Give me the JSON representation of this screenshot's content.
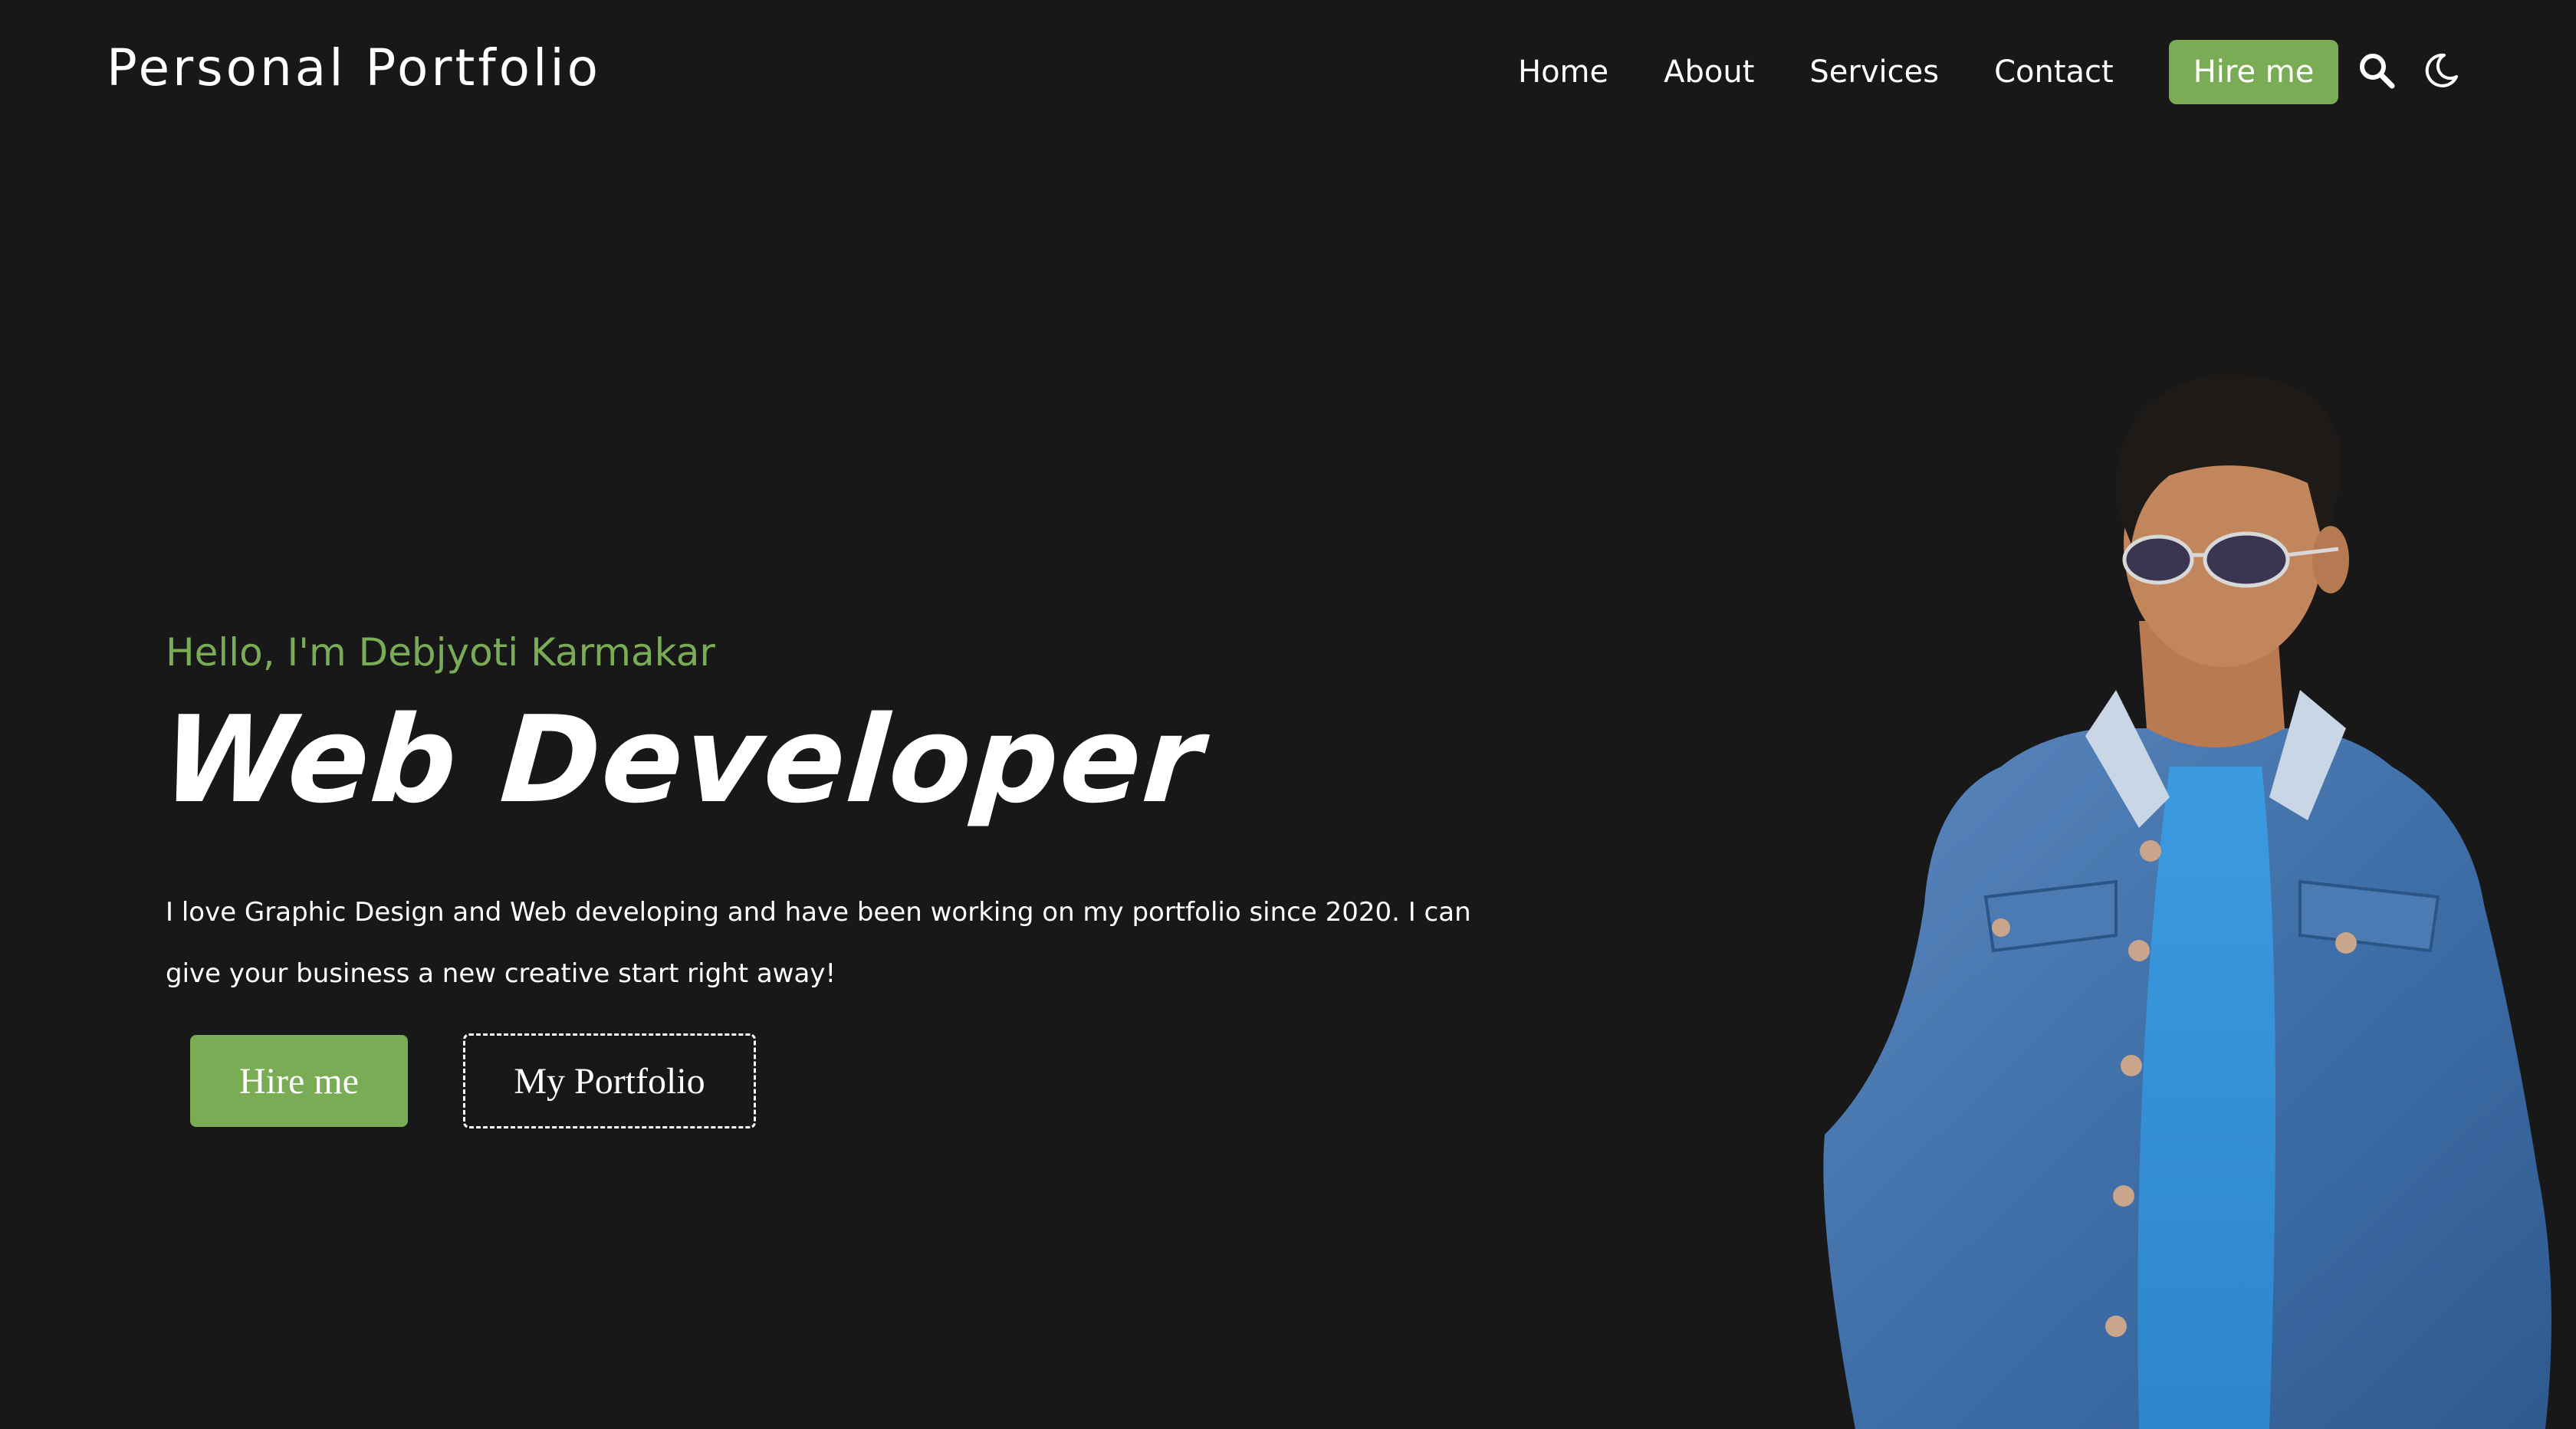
{
  "header": {
    "logo": "Personal Portfolio",
    "nav": {
      "home": "Home",
      "about": "About",
      "services": "Services",
      "contact": "Contact",
      "hire": "Hire me"
    },
    "icons": [
      "search-icon",
      "moon-icon"
    ]
  },
  "hero": {
    "greeting": "Hello, I'm Debjyoti Karmakar",
    "title": "Web Developer",
    "description": "I love Graphic Design and Web developing and have been working on my portfolio since 2020. I can give your business a new creative start right away!",
    "hire_button": "Hire me",
    "portfolio_button": "My Portfolio"
  },
  "colors": {
    "background": "#181818",
    "accent": "#7aac56",
    "text": "#ffffff"
  }
}
